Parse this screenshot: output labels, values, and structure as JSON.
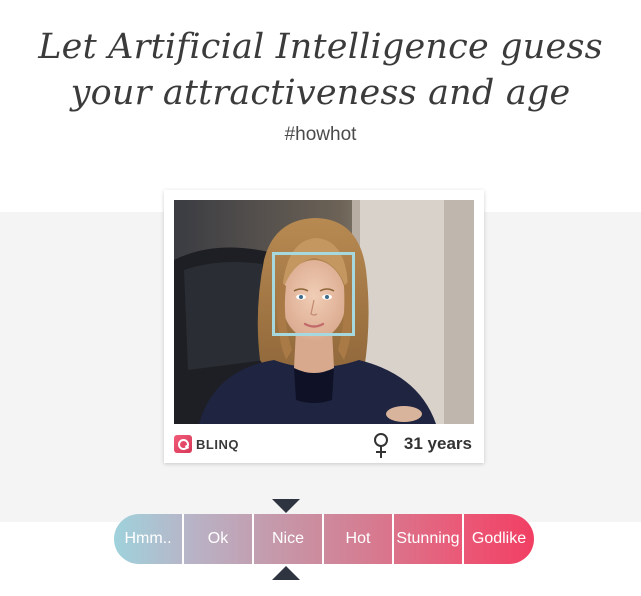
{
  "header": {
    "headline_line1": "Let Artificial Intelligence guess",
    "headline_line2": "your attractiveness and age",
    "hashtag": "#howhot"
  },
  "card": {
    "brand": "BLINQ",
    "gender_icon": "female-symbol-icon",
    "age_label": "31 years"
  },
  "rating": {
    "options": [
      "Hmm..",
      "Ok",
      "Nice",
      "Hot",
      "Stunning",
      "Godlike"
    ],
    "selected": "Nice",
    "gradient_start": "#9fd2dc",
    "gradient_end": "#f13f63",
    "pointer_color": "#2e3440"
  },
  "colors": {
    "face_box": "#a6d9df",
    "band_background": "#f4f4f4"
  }
}
